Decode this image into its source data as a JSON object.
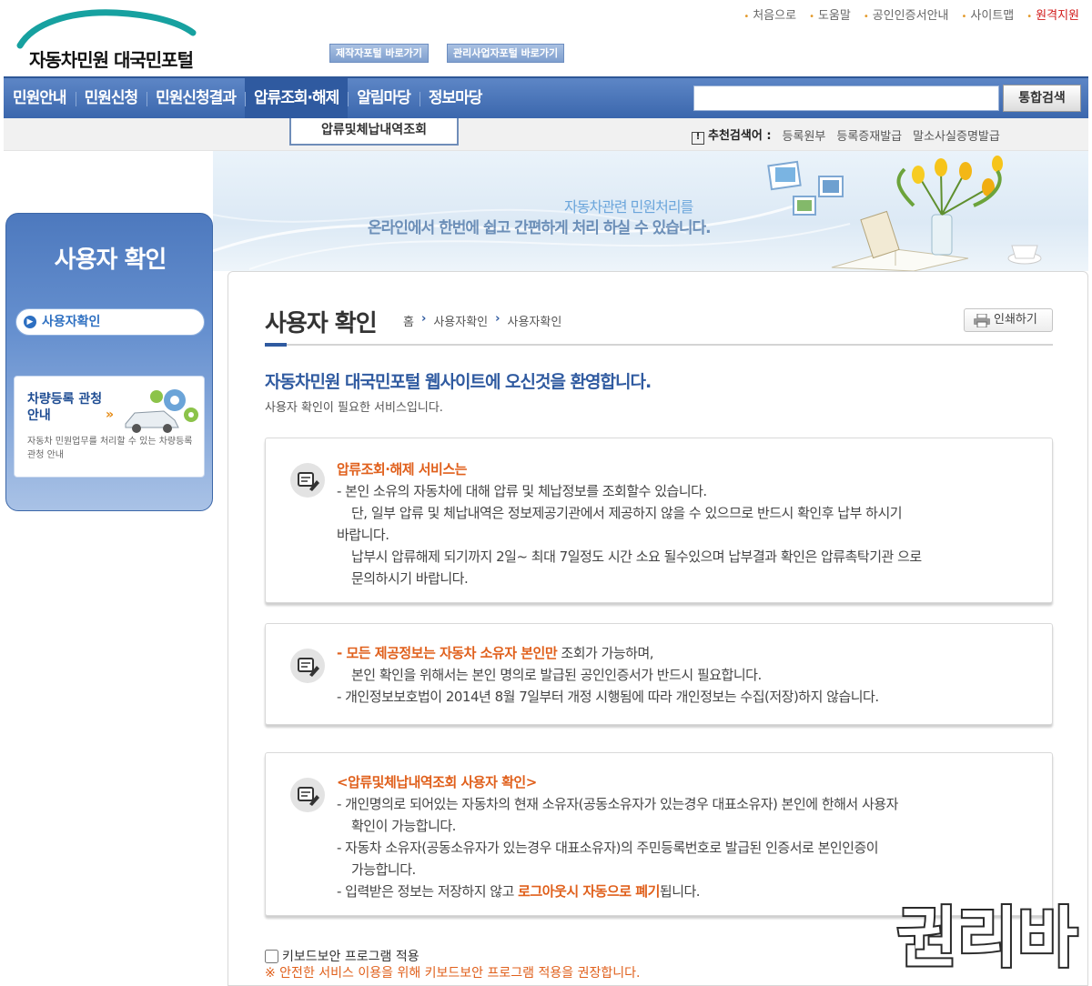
{
  "header": {
    "logo_text": "자동차민원 대국민포털",
    "portal_buttons": [
      "제작자포털 바로가기",
      "관리사업자포털 바로가기"
    ],
    "util_links": [
      "처음으로",
      "도움말",
      "공인인증서안내",
      "사이트맵",
      "원격지원"
    ]
  },
  "gnb": {
    "items": [
      "민원안내",
      "민원신청",
      "민원신청결과",
      "압류조회·해제",
      "알림마당",
      "정보마당"
    ],
    "submenu": "압류및체납내역조회",
    "search_button": "통합검색",
    "search_value": ""
  },
  "recommend": {
    "label": "추천검색어 :",
    "links": [
      "등록원부",
      "등록증재발급",
      "말소사실증명발급"
    ]
  },
  "banner": {
    "line1": "자동차관련 민원처리를",
    "line2": "온라인에서 한번에 쉽고 간편하게 처리 하실 수 있습니다."
  },
  "sidebar": {
    "title": "사용자 확인",
    "item": "사용자확인",
    "promo_title": "차량등록 관청 안내",
    "promo_desc": "자동차 민원업무를 처리할 수 있는 차량등록관청 안내"
  },
  "content": {
    "title": "사용자 확인",
    "breadcrumb": [
      "홈",
      "사용자확인",
      "사용자확인"
    ],
    "print_label": "인쇄하기",
    "welcome": "자동차민원 대국민포털 웹사이트에 오신것을 환영합니다.",
    "welcome_sub": "사용자 확인이 필요한 서비스입니다.",
    "box1": {
      "heading": "압류조회·해제 서비스는",
      "line1": "- 본인 소유의 자동차에 대해 압류 및 체납정보를 조회할수 있습니다.",
      "line2": "단, 일부 압류 및 체납내역은 정보제공기관에서 제공하지 않을 수 있으므로 반드시 확인후 납부 하시기",
      "line3": "바랍니다.",
      "line4": "납부시 압류해제 되기까지 2일~ 최대 7일정도 시간 소요 될수있으며 납부결과 확인은 압류촉탁기관 으로",
      "line5": "문의하시기 바랍니다."
    },
    "box2": {
      "line1_highlight": "- 모든 제공정보는 자동차 소유자 본인만",
      "line1_rest": " 조회가 가능하며,",
      "line2": "본인 확인을 위해서는 본인 명의로 발급된 공인인증서가 반드시 필요합니다.",
      "line3": "- 개인정보보호법이 2014년 8월 7일부터 개정 시행됨에 따라 개인정보는 수집(저장)하지 않습니다."
    },
    "box3": {
      "heading": "<압류및체납내역조회 사용자 확인>",
      "line1": "- 개인명의로 되어있는 자동차의 현재 소유자(공동소유자가 있는경우 대표소유자) 본인에 한해서 사용자",
      "line2": "확인이 가능합니다.",
      "line3": "- 자동차 소유자(공동소유자가 있는경우 대표소유자)의 주민등록번호로 발급된 인증서로 본인인증이",
      "line4": "가능합니다.",
      "line5_pre": "- 입력받은 정보는 저장하지 않고 ",
      "line5_highlight": "로그아웃시 자동으로 폐기",
      "line5_post": "됩니다."
    },
    "keyboard_label": "키보드보안 프로그램 적용",
    "keyboard_note": "※ 안전한 서비스 이용을 위해 키보드보안 프로그램 적용을 권장합니다."
  },
  "watermark": "권리바",
  "colors": {
    "nav_blue": "#3b67ad",
    "accent_orange": "#e0601c",
    "title_blue": "#2f5aa0"
  }
}
